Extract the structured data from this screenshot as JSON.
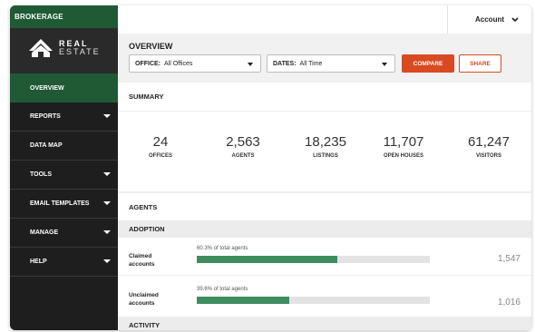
{
  "sidebar": {
    "brand_label": "BROKERAGE",
    "logo": {
      "line1": "REAL",
      "line2": "ESTATE"
    },
    "items": [
      {
        "label": "OVERVIEW",
        "active": true,
        "has_caret": false
      },
      {
        "label": "REPORTS",
        "active": false,
        "has_caret": true
      },
      {
        "label": "DATA MAP",
        "active": false,
        "has_caret": false
      },
      {
        "label": "TOOLS",
        "active": false,
        "has_caret": true
      },
      {
        "label": "EMAIL TEMPLATES",
        "active": false,
        "has_caret": true
      },
      {
        "label": "MANAGE",
        "active": false,
        "has_caret": true
      },
      {
        "label": "HELP",
        "active": false,
        "has_caret": true
      }
    ]
  },
  "topbar": {
    "account_label": "Account",
    "account_icon": "chevron-down-icon"
  },
  "overview": {
    "title": "OVERVIEW",
    "office_filter": {
      "label": "OFFICE:",
      "value": "All Offices"
    },
    "dates_filter": {
      "label": "DATES:",
      "value": "All Time"
    },
    "compare_label": "COMPARE",
    "share_label": "SHARE"
  },
  "summary": {
    "title": "SUMMARY",
    "stats": [
      {
        "value": "24",
        "label": "OFFICES"
      },
      {
        "value": "2,563",
        "label": "AGENTS"
      },
      {
        "value": "18,235",
        "label": "LISTINGS"
      },
      {
        "value": "11,707",
        "label": "OPEN HOUSES"
      },
      {
        "value": "61,247",
        "label": "VISITORS"
      }
    ]
  },
  "agents": {
    "title": "AGENTS",
    "adoption_title": "ADOPTION",
    "rows": [
      {
        "label_line1": "Claimed",
        "label_line2": "accounts",
        "note": "60.3% of total agents",
        "percent": 60.3,
        "count": "1,547"
      },
      {
        "label_line1": "Unclaimed",
        "label_line2": "accounts",
        "note": "39.6% of total agents",
        "percent": 39.6,
        "count": "1,016"
      }
    ]
  },
  "activity": {
    "title": "ACTIVITY"
  },
  "colors": {
    "brand_green": "#1f5a35",
    "accent_orange": "#d94a22",
    "bar_green": "#3f8d5f"
  }
}
